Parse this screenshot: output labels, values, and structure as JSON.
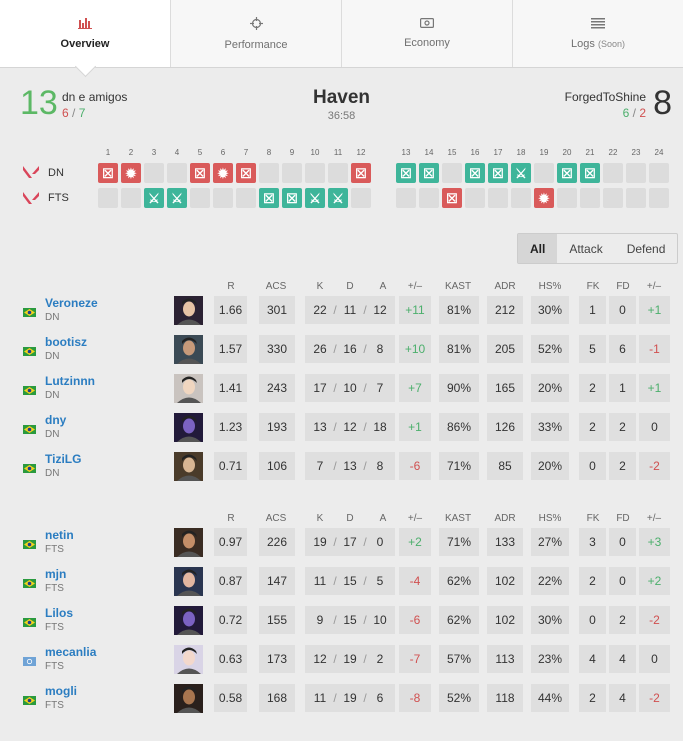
{
  "tabs": [
    {
      "label": "Overview",
      "icon": "bar-chart-icon",
      "active": true
    },
    {
      "label": "Performance",
      "icon": "crosshair-icon"
    },
    {
      "label": "Economy",
      "icon": "money-icon"
    },
    {
      "label": "Logs",
      "suffix": "(Soon)",
      "icon": "list-icon"
    }
  ],
  "match": {
    "team1": {
      "name": "dn e amigos",
      "score": "13",
      "record_attack": "6",
      "record_defense": "7",
      "short": "DN"
    },
    "team2": {
      "name": "ForgedToShine",
      "score": "8",
      "record_attack": "6",
      "record_defense": "2",
      "short": "FTS"
    },
    "map": "Haven",
    "duration": "36:58",
    "sep": "/"
  },
  "rounds": {
    "numbers": [
      "1",
      "2",
      "3",
      "4",
      "5",
      "6",
      "7",
      "8",
      "9",
      "10",
      "11",
      "12",
      "13",
      "14",
      "15",
      "16",
      "17",
      "18",
      "19",
      "20",
      "21",
      "22",
      "23",
      "24"
    ],
    "dn": [
      "red-elim",
      "red-boom",
      "",
      "",
      "red-elim",
      "red-boom",
      "red-elim",
      "",
      "",
      "",
      "",
      "red-elim",
      "green-elim",
      "green-elim",
      "",
      "green-elim",
      "green-elim",
      "green-defuse",
      "",
      "green-elim",
      "green-elim",
      "",
      "",
      ""
    ],
    "fts": [
      "",
      "",
      "green-defuse",
      "green-defuse",
      "",
      "",
      "",
      "green-elim",
      "green-elim",
      "green-defuse",
      "green-defuse",
      "",
      "",
      "",
      "red-elim",
      "",
      "",
      "",
      "red-boom",
      "",
      "",
      "",
      "",
      ""
    ],
    "colors": {
      "red": "#d95a5a",
      "green": "#3eb59a",
      "empty": "#dcdcdc"
    }
  },
  "filter": {
    "options": [
      "All",
      "Attack",
      "Defend"
    ],
    "selected": "All"
  },
  "headers": [
    "R",
    "ACS",
    "K",
    "D",
    "A",
    "+/–",
    "KAST",
    "ADR",
    "HS%",
    "FK",
    "FD",
    "+/–"
  ],
  "team1_players": [
    {
      "name": "Veroneze",
      "team": "DN",
      "r": "1.66",
      "acs": "301",
      "k": "22",
      "d": "11",
      "a": "12",
      "pm": "+11",
      "kast": "81%",
      "adr": "212",
      "hs": "30%",
      "fk": "1",
      "fd": "0",
      "fpm": "+1"
    },
    {
      "name": "bootisz",
      "team": "DN",
      "r": "1.57",
      "acs": "330",
      "k": "26",
      "d": "16",
      "a": "8",
      "pm": "+10",
      "kast": "81%",
      "adr": "205",
      "hs": "52%",
      "fk": "5",
      "fd": "6",
      "fpm": "-1"
    },
    {
      "name": "Lutzinnn",
      "team": "DN",
      "r": "1.41",
      "acs": "243",
      "k": "17",
      "d": "10",
      "a": "7",
      "pm": "+7",
      "kast": "90%",
      "adr": "165",
      "hs": "20%",
      "fk": "2",
      "fd": "1",
      "fpm": "+1"
    },
    {
      "name": "dny",
      "team": "DN",
      "r": "1.23",
      "acs": "193",
      "k": "13",
      "d": "12",
      "a": "18",
      "pm": "+1",
      "kast": "86%",
      "adr": "126",
      "hs": "33%",
      "fk": "2",
      "fd": "2",
      "fpm": "0"
    },
    {
      "name": "TiziLG",
      "team": "DN",
      "r": "0.71",
      "acs": "106",
      "k": "7",
      "d": "13",
      "a": "8",
      "pm": "-6",
      "kast": "71%",
      "adr": "85",
      "hs": "20%",
      "fk": "0",
      "fd": "2",
      "fpm": "-2"
    }
  ],
  "team2_players": [
    {
      "name": "netin",
      "team": "FTS",
      "r": "0.97",
      "acs": "226",
      "k": "19",
      "d": "17",
      "a": "0",
      "pm": "+2",
      "kast": "71%",
      "adr": "133",
      "hs": "27%",
      "fk": "3",
      "fd": "0",
      "fpm": "+3"
    },
    {
      "name": "mjn",
      "team": "FTS",
      "r": "0.87",
      "acs": "147",
      "k": "11",
      "d": "15",
      "a": "5",
      "pm": "-4",
      "kast": "62%",
      "adr": "102",
      "hs": "22%",
      "fk": "2",
      "fd": "0",
      "fpm": "+2"
    },
    {
      "name": "Lilos",
      "team": "FTS",
      "r": "0.72",
      "acs": "155",
      "k": "9",
      "d": "15",
      "a": "10",
      "pm": "-6",
      "kast": "62%",
      "adr": "102",
      "hs": "30%",
      "fk": "0",
      "fd": "2",
      "fpm": "-2"
    },
    {
      "name": "mecanlia",
      "team": "FTS",
      "r": "0.63",
      "acs": "173",
      "k": "12",
      "d": "19",
      "a": "2",
      "pm": "-7",
      "kast": "57%",
      "adr": "113",
      "hs": "23%",
      "fk": "4",
      "fd": "4",
      "fpm": "0"
    },
    {
      "name": "mogli",
      "team": "FTS",
      "r": "0.58",
      "acs": "168",
      "k": "11",
      "d": "19",
      "a": "6",
      "pm": "-8",
      "kast": "52%",
      "adr": "118",
      "hs": "44%",
      "fk": "2",
      "fd": "4",
      "fpm": "-2"
    }
  ],
  "flags": [
    "br",
    "br",
    "br",
    "br",
    "br",
    "br",
    "br",
    "br",
    "un",
    "br"
  ],
  "colors": {
    "positive": "#4caf6c",
    "negative": "#d05050",
    "link": "#2b7dc1",
    "accent_green": "#5cb865"
  }
}
